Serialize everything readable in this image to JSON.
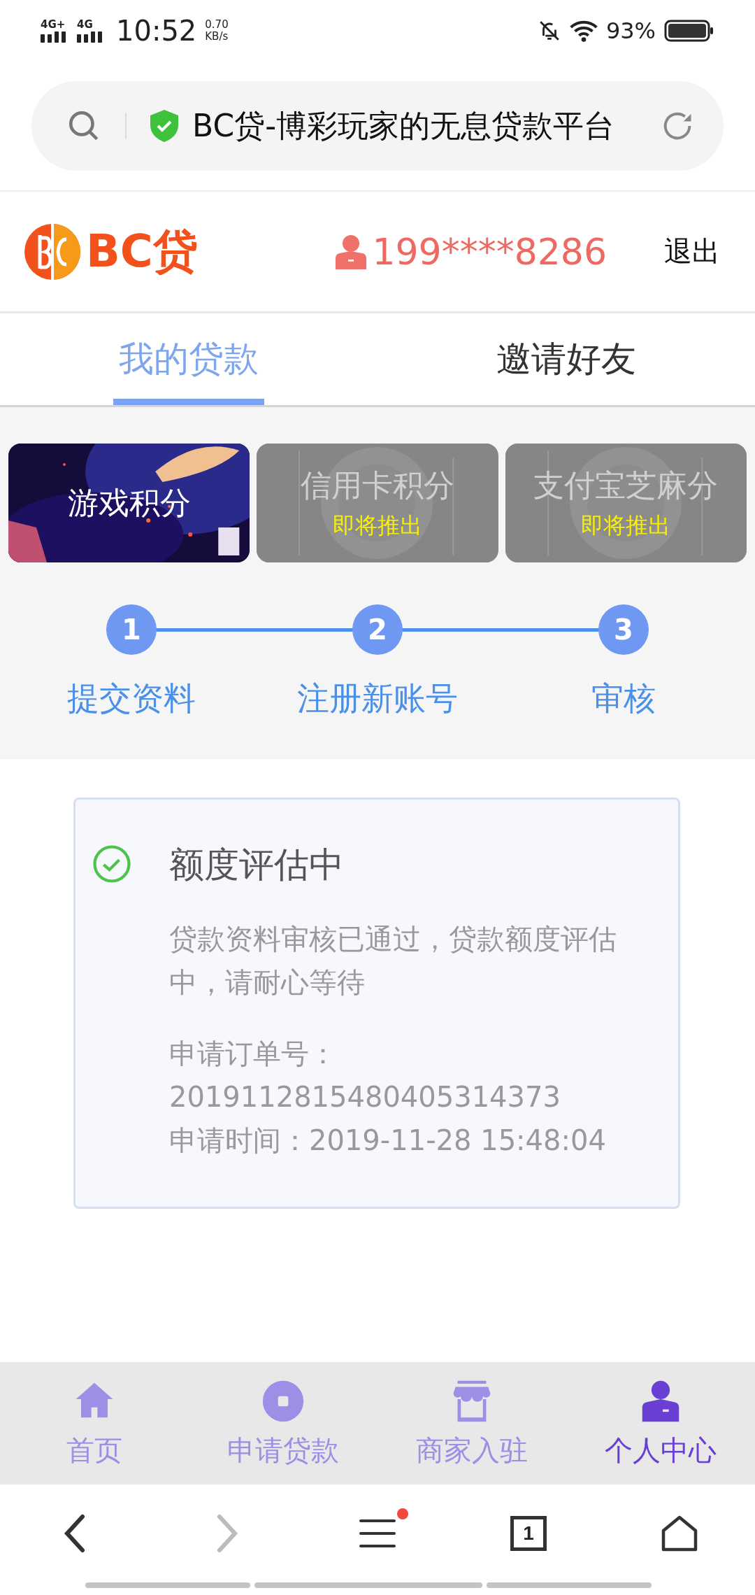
{
  "status_bar": {
    "networks": [
      "4G+",
      "4G"
    ],
    "time": "10:52",
    "speed_value": "0.70",
    "speed_unit": "KB/s",
    "battery": "93%"
  },
  "address_bar": {
    "title": "BC贷-博彩玩家的无息贷款平台"
  },
  "header": {
    "logo": "BC贷",
    "phone": "199****8286",
    "logout": "退出"
  },
  "tabs": [
    {
      "label": "我的贷款",
      "selected": true
    },
    {
      "label": "邀请好友",
      "selected": false
    }
  ],
  "score_cards": [
    {
      "title": "游戏积分",
      "disabled": false
    },
    {
      "title": "信用卡积分",
      "note": "即将推出",
      "disabled": true
    },
    {
      "title": "支付宝芝麻分",
      "note": "即将推出",
      "disabled": true
    }
  ],
  "steps": [
    {
      "number": "1",
      "label": "提交资料"
    },
    {
      "number": "2",
      "label": "注册新账号"
    },
    {
      "number": "3",
      "label": "审核"
    }
  ],
  "status_card": {
    "title": "额度评估中",
    "message": "贷款资料审核已通过，贷款额度评估中，请耐心等待",
    "order_label": "申请订单号：",
    "order_number": "2019112815480405314373",
    "time": "申请时间：2019-11-28 15:48:04"
  },
  "bottom_nav": [
    {
      "label": "首页",
      "kind": "home",
      "selected": false
    },
    {
      "label": "申请贷款",
      "kind": "apply",
      "selected": false
    },
    {
      "label": "商家入驻",
      "kind": "shop",
      "selected": false
    },
    {
      "label": "个人中心",
      "kind": "profile",
      "selected": true
    }
  ],
  "browser_bar": [
    {
      "kind": "back",
      "disabled": false
    },
    {
      "kind": "forward",
      "disabled": true
    },
    {
      "kind": "menu",
      "notification": true
    },
    {
      "kind": "tabs",
      "count": "1"
    },
    {
      "kind": "home"
    }
  ]
}
